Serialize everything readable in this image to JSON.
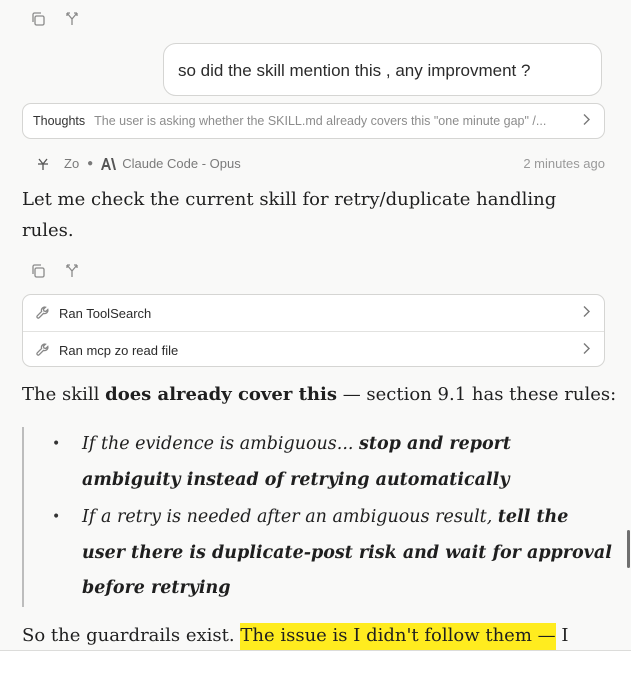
{
  "top_actions": [
    {
      "icon": "copy-icon"
    },
    {
      "icon": "branch-icon"
    }
  ],
  "user_message": "so did the skill mention this , any improvment ?",
  "thoughts": {
    "label": "Thoughts",
    "preview": "The user is asking whether the SKILL.md already covers this \"one minute gap\" /..."
  },
  "meta": {
    "agent_name": "Zo",
    "model": "Claude Code - Opus",
    "timestamp": "2 minutes ago"
  },
  "assistant": {
    "intro": "Let me check the current skill for retry/duplicate handling rules.",
    "tools": [
      {
        "label": "Ran ToolSearch",
        "icon": "wrench-icon"
      },
      {
        "label": "Ran mcp zo read file",
        "icon": "wrench-icon"
      }
    ],
    "p2_start": "The skill ",
    "p2_bold": "does already cover this",
    "p2_end": " — section 9.1 has these rules:",
    "bullets": [
      {
        "italic": "If the evidence is ambiguous... ",
        "bold": "stop and report ambiguity instead of retrying automatically"
      },
      {
        "italic": "If a retry is needed after an ambiguous result, ",
        "bold": "tell the user there is duplicate-post risk and wait for approval before retrying"
      }
    ],
    "p3_start": "So the guardrails exist. ",
    "p3_highlight": "The issue is I didn't follow them —",
    "p3_end": " I"
  },
  "highlight_color": "#ffec1f"
}
